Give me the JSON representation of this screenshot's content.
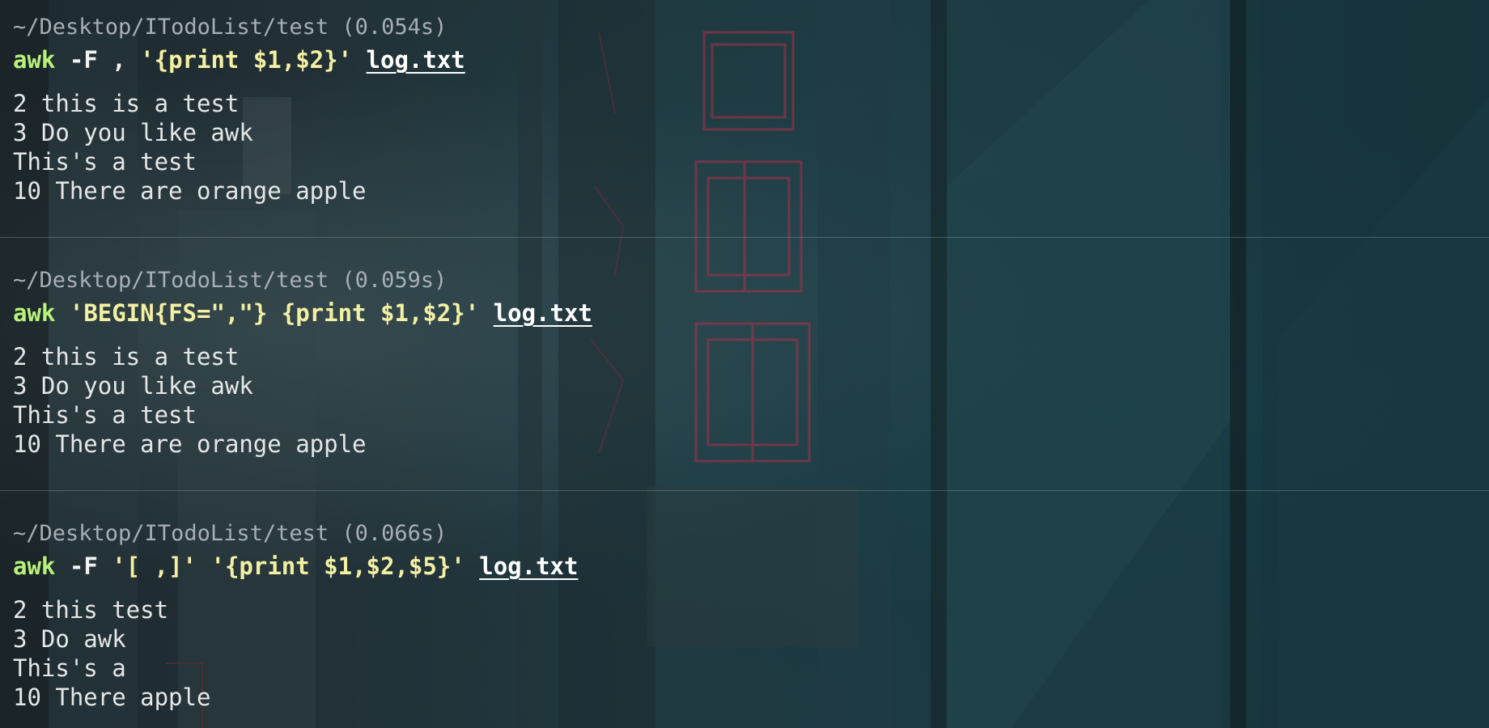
{
  "blocks": [
    {
      "path": "~/Desktop/ITodoList/test (0.054s)",
      "command": {
        "program": "awk",
        "parts": [
          {
            "type": "flag",
            "text": "-F ,"
          },
          {
            "type": "str",
            "text": "'{print $1,$2}'"
          },
          {
            "type": "file",
            "text": "log.txt"
          }
        ]
      },
      "output": [
        "2 this is a test",
        "3 Do you like awk",
        "This's a test",
        "10 There are orange apple"
      ]
    },
    {
      "path": "~/Desktop/ITodoList/test (0.059s)",
      "command": {
        "program": "awk",
        "parts": [
          {
            "type": "str",
            "text": "'BEGIN{FS=\",\"} {print $1,$2}'"
          },
          {
            "type": "file",
            "text": "log.txt"
          }
        ]
      },
      "output": [
        "2 this is a test",
        "3 Do you like awk",
        "This's a test",
        "10 There are orange apple"
      ]
    },
    {
      "path": "~/Desktop/ITodoList/test (0.066s)",
      "command": {
        "program": "awk",
        "parts": [
          {
            "type": "flag",
            "text": "-F"
          },
          {
            "type": "str",
            "text": "'[ ,]'"
          },
          {
            "type": "str",
            "text": "'{print $1,$2,$5}'"
          },
          {
            "type": "file",
            "text": "log.txt"
          }
        ]
      },
      "output": [
        "2 this test",
        "3 Do awk",
        "This's a",
        "10 There apple"
      ]
    }
  ],
  "colors": {
    "program": "#b9f27a",
    "flag": "#f2f2f2",
    "string": "#f4f0a3",
    "file": "#ffffff",
    "path": "#a6afb3",
    "output": "#e4e7e8"
  }
}
